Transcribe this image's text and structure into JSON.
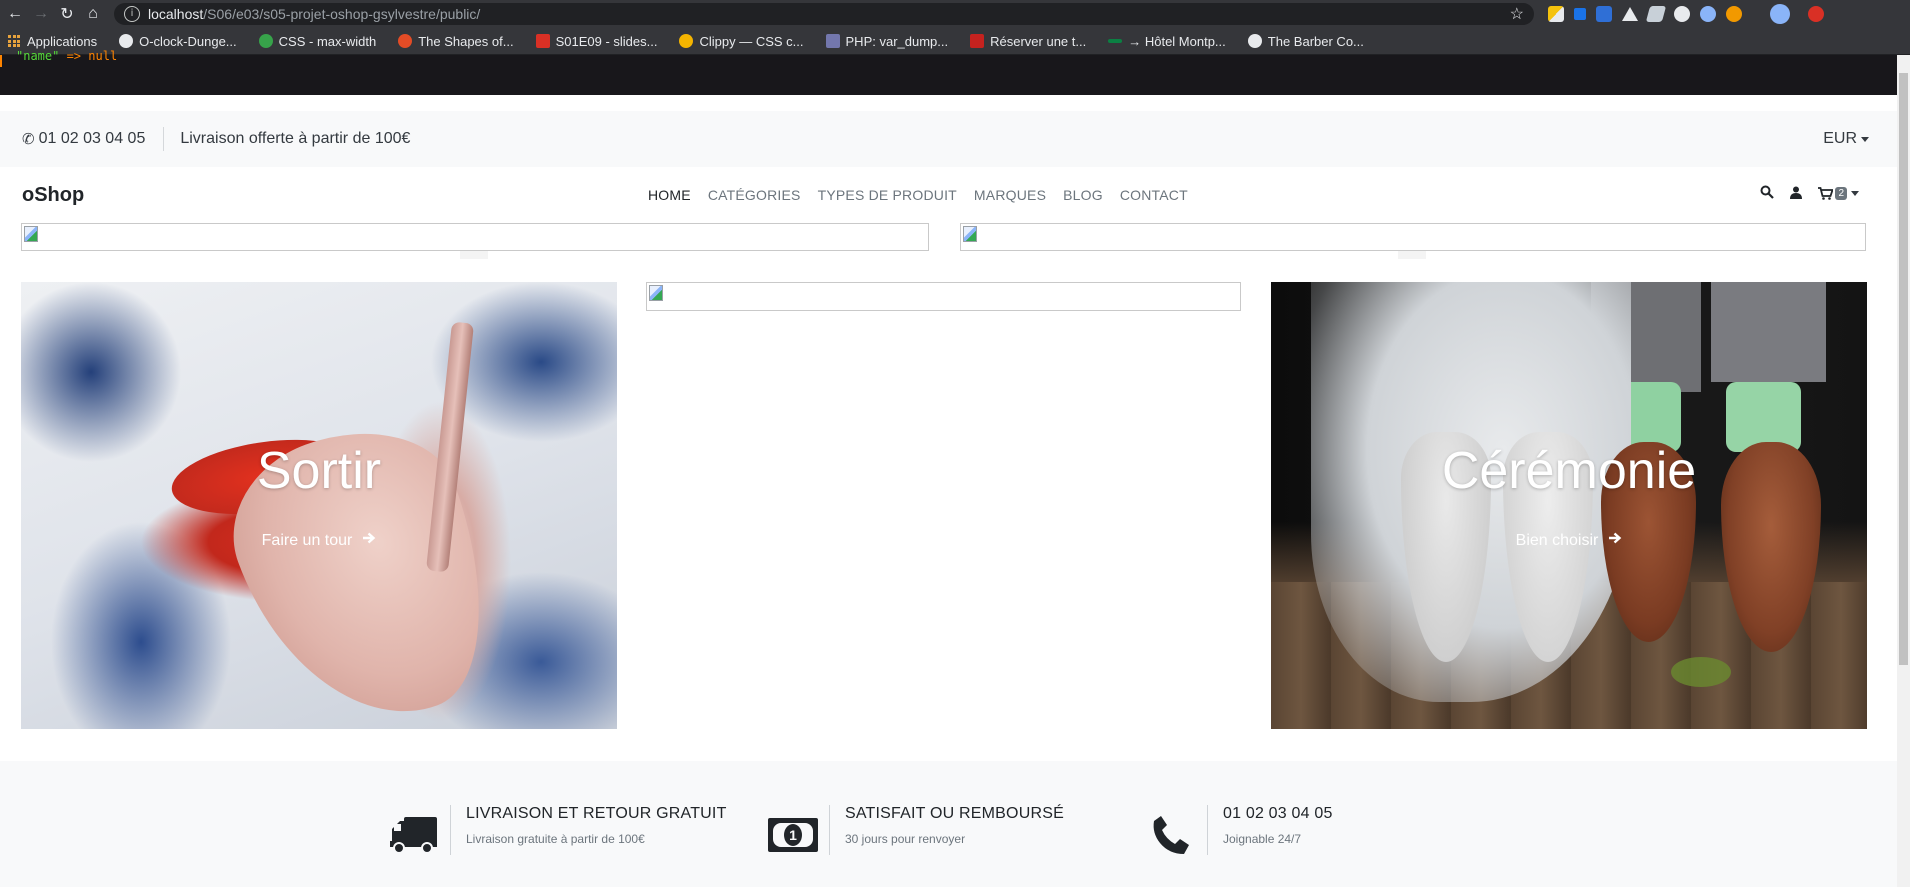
{
  "browser": {
    "url_host": "localhost",
    "url_path": "/S06/e03/s05-projet-oshop-gsylvestre/public/",
    "bookmarks": [
      {
        "label": "Applications",
        "color": "#e8a33d"
      },
      {
        "label": "O-clock-Dunge...",
        "color": "#e8eaed"
      },
      {
        "label": "CSS - max-width",
        "color": "#37a34a"
      },
      {
        "label": "The Shapes of...",
        "color": "#e34c26"
      },
      {
        "label": "S01E09 - slides...",
        "color": "#d93025"
      },
      {
        "label": "Clippy — CSS c...",
        "color": "#f4b400"
      },
      {
        "label": "PHP: var_dump...",
        "color": "#7377ad"
      },
      {
        "label": "Réserver une t...",
        "color": "#c5221f"
      },
      {
        "label": "→ Hôtel Montp...",
        "color": "#0b8043"
      },
      {
        "label": "The Barber Co...",
        "color": "#e8eaed"
      }
    ]
  },
  "debug": {
    "key": "\"name\"",
    "arrow": " => ",
    "value": "null"
  },
  "topbar": {
    "phone": "01 02 03 04 05",
    "shipping": "Livraison offerte à partir de 100€",
    "currency": "EUR"
  },
  "navbar": {
    "brand": "oShop",
    "links": [
      "HOME",
      "CATÉGORIES",
      "TYPES DE PRODUIT",
      "MARQUES",
      "BLOG",
      "CONTACT"
    ],
    "active_link": "HOME",
    "cart_count": "2"
  },
  "tiles": [
    {
      "title": "Sortir",
      "link": "Faire un tour"
    },
    {
      "title": "Cérémonie",
      "link": "Bien choisir"
    }
  ],
  "services": [
    {
      "icon": "truck-icon",
      "title": "LIVRAISON ET RETOUR GRATUIT",
      "subtitle": "Livraison gratuite à partir de 100€"
    },
    {
      "icon": "money-icon",
      "title": "SATISFAIT OU REMBOURSÉ",
      "subtitle": "30 jours pour renvoyer"
    },
    {
      "icon": "phone-icon",
      "title": "01 02 03 04 05",
      "subtitle": "Joignable 24/7"
    }
  ]
}
